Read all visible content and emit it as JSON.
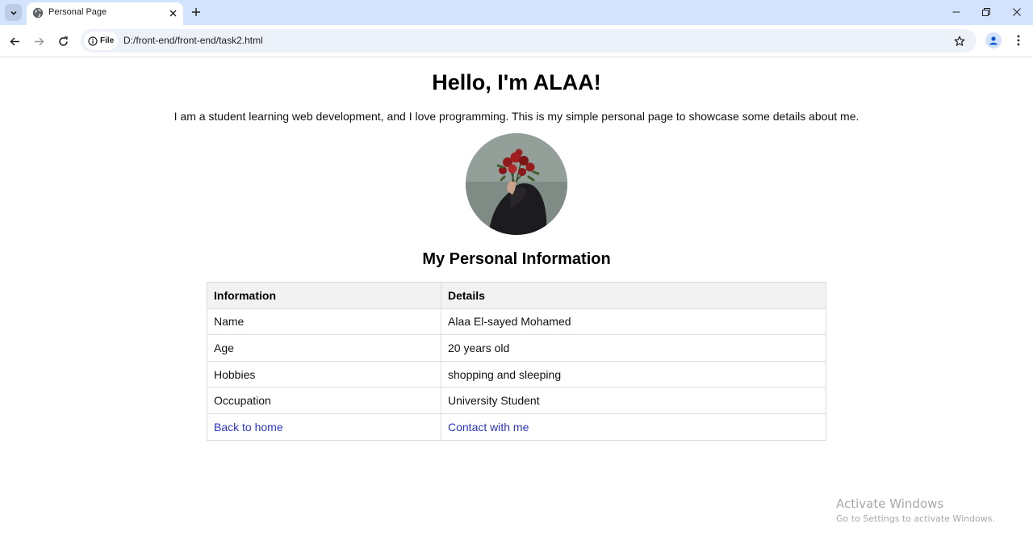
{
  "browser": {
    "tab_title": "Personal Page",
    "site_chip_label": "File",
    "url": "D:/front-end/front-end/task2.html"
  },
  "page": {
    "heading": "Hello, I'm ALAA!",
    "intro": "I am a student learning web development, and I love programming. This is my simple personal page to showcase some details about me.",
    "section_title": "My Personal Information",
    "table": {
      "headers": [
        "Information",
        "Details"
      ],
      "rows": [
        [
          "Name",
          "Alaa El-sayed Mohamed"
        ],
        [
          "Age",
          "20 years old"
        ],
        [
          "Hobbies",
          "shopping and sleeping"
        ],
        [
          "Occupation",
          "University Student"
        ]
      ],
      "links": [
        "Back to home",
        "Contact with me"
      ]
    }
  },
  "watermark": {
    "title": "Activate Windows",
    "subtitle": "Go to Settings to activate Windows."
  },
  "colors": {
    "tabstrip": "#d3e3fd",
    "link": "#2c35c9",
    "table_header_bg": "#f2f2f2",
    "table_border": "#dcdcdc"
  }
}
